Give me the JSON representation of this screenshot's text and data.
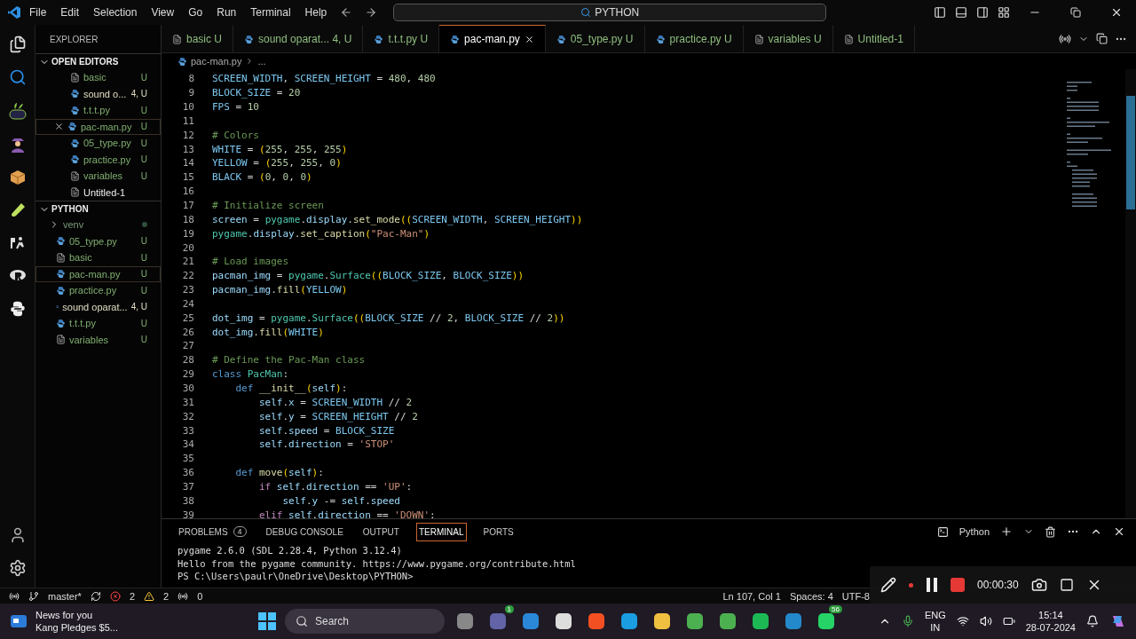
{
  "window": {
    "menu": [
      "File",
      "Edit",
      "Selection",
      "View",
      "Go",
      "Run",
      "Terminal",
      "Help"
    ],
    "command_center": "PYTHON"
  },
  "tabs": [
    {
      "label": "basic",
      "kind": "text",
      "badge": "U",
      "selected": false
    },
    {
      "label": "sound oparat...",
      "kind": "python",
      "badge": "4, U",
      "selected": false
    },
    {
      "label": "t.t.t.py",
      "kind": "python",
      "badge": "U",
      "selected": false
    },
    {
      "label": "pac-man.py",
      "kind": "python",
      "selected": true
    },
    {
      "label": "05_type.py",
      "kind": "python",
      "badge": "U",
      "selected": false
    },
    {
      "label": "practice.py",
      "kind": "python",
      "badge": "U",
      "selected": false
    },
    {
      "label": "variables",
      "kind": "text",
      "badge": "U",
      "selected": false
    },
    {
      "label": "Untitled-1",
      "kind": "text",
      "selected": false
    }
  ],
  "sidebar": {
    "title": "EXPLORER",
    "sections": [
      {
        "title": "OPEN EDITORS",
        "expanded": true,
        "items": [
          {
            "label": "basic",
            "kind": "text",
            "badge": "U",
            "untracked": true,
            "has_errors": false,
            "selected": false
          },
          {
            "label": "sound o...",
            "kind": "python",
            "badge": "4, U",
            "untracked": true,
            "has_errors": true,
            "selected": false
          },
          {
            "label": "t.t.t.py",
            "kind": "python",
            "badge": "U",
            "untracked": true,
            "has_errors": false,
            "selected": false
          },
          {
            "label": "pac-man.py",
            "kind": "python",
            "badge": "U",
            "untracked": true,
            "has_errors": false,
            "selected": true
          },
          {
            "label": "05_type.py",
            "kind": "python",
            "badge": "U",
            "untracked": true,
            "has_errors": false,
            "selected": false
          },
          {
            "label": "practice.py",
            "kind": "python",
            "badge": "U",
            "untracked": true,
            "has_errors": false,
            "selected": false
          },
          {
            "label": "variables",
            "kind": "text",
            "badge": "U",
            "untracked": true,
            "has_errors": false,
            "selected": false
          },
          {
            "label": "Untitled-1",
            "kind": "text",
            "untracked": false,
            "has_errors": false,
            "selected": false
          }
        ]
      },
      {
        "title": "PYTHON",
        "expanded": true,
        "items": [
          {
            "label": "venv",
            "kind": "folder",
            "untracked": true,
            "has_errors": false,
            "selected": false
          },
          {
            "label": "05_type.py",
            "kind": "python",
            "badge": "U",
            "untracked": true,
            "has_errors": false,
            "selected": false
          },
          {
            "label": "basic",
            "kind": "text",
            "badge": "U",
            "untracked": true,
            "has_errors": false,
            "selected": false
          },
          {
            "label": "pac-man.py",
            "kind": "python",
            "badge": "U",
            "untracked": true,
            "has_errors": false,
            "selected": true
          },
          {
            "label": "practice.py",
            "kind": "python",
            "badge": "U",
            "untracked": true,
            "has_errors": false,
            "selected": false
          },
          {
            "label": "sound oparat...",
            "kind": "python",
            "badge": "4, U",
            "untracked": true,
            "has_errors": true,
            "selected": false
          },
          {
            "label": "t.t.t.py",
            "kind": "python",
            "badge": "U",
            "untracked": true,
            "has_errors": false,
            "selected": false
          },
          {
            "label": "variables",
            "kind": "text",
            "badge": "U",
            "untracked": true,
            "has_errors": false,
            "selected": false
          }
        ]
      }
    ]
  },
  "breadcrumb": [
    "pac-man.py",
    "..."
  ],
  "editor": {
    "lines": [
      {
        "n": "8",
        "parts": [
          {
            "kind": "const",
            "text": "SCREEN_WIDTH"
          },
          {
            "kind": "op",
            "text": ", "
          },
          {
            "kind": "const",
            "text": "SCREEN_HEIGHT"
          },
          {
            "kind": "op",
            "text": " = "
          },
          {
            "kind": "num",
            "text": "480"
          },
          {
            "kind": "op",
            "text": ", "
          },
          {
            "kind": "num",
            "text": "480"
          }
        ]
      },
      {
        "n": "9",
        "parts": [
          {
            "kind": "const",
            "text": "BLOCK_SIZE"
          },
          {
            "kind": "op",
            "text": " = "
          },
          {
            "kind": "num",
            "text": "20"
          }
        ]
      },
      {
        "n": "10",
        "parts": [
          {
            "kind": "const",
            "text": "FPS"
          },
          {
            "kind": "op",
            "text": " = "
          },
          {
            "kind": "num",
            "text": "10"
          }
        ]
      },
      {
        "n": "11"
      },
      {
        "n": "12",
        "parts": [
          {
            "kind": "comment",
            "text": "# Colors"
          }
        ]
      },
      {
        "n": "13",
        "parts": [
          {
            "kind": "const",
            "text": "WHITE"
          },
          {
            "kind": "op",
            "text": " = "
          },
          {
            "kind": "paren",
            "text": "("
          },
          {
            "kind": "num",
            "text": "255"
          },
          {
            "kind": "op",
            "text": ", "
          },
          {
            "kind": "num",
            "text": "255"
          },
          {
            "kind": "op",
            "text": ", "
          },
          {
            "kind": "num",
            "text": "255"
          },
          {
            "kind": "paren",
            "text": ")"
          }
        ]
      },
      {
        "n": "14",
        "parts": [
          {
            "kind": "const",
            "text": "YELLOW"
          },
          {
            "kind": "op",
            "text": " = "
          },
          {
            "kind": "paren",
            "text": "("
          },
          {
            "kind": "num",
            "text": "255"
          },
          {
            "kind": "op",
            "text": ", "
          },
          {
            "kind": "num",
            "text": "255"
          },
          {
            "kind": "op",
            "text": ", "
          },
          {
            "kind": "num",
            "text": "0"
          },
          {
            "kind": "paren",
            "text": ")"
          }
        ]
      },
      {
        "n": "15",
        "parts": [
          {
            "kind": "const",
            "text": "BLACK"
          },
          {
            "kind": "op",
            "text": " = "
          },
          {
            "kind": "paren",
            "text": "("
          },
          {
            "kind": "num",
            "text": "0"
          },
          {
            "kind": "op",
            "text": ", "
          },
          {
            "kind": "num",
            "text": "0"
          },
          {
            "kind": "op",
            "text": ", "
          },
          {
            "kind": "num",
            "text": "0"
          },
          {
            "kind": "paren",
            "text": ")"
          }
        ]
      },
      {
        "n": "16"
      },
      {
        "n": "17",
        "parts": [
          {
            "kind": "comment",
            "text": "# Initialize screen"
          }
        ]
      },
      {
        "n": "18",
        "parts": [
          {
            "kind": "var",
            "text": "screen"
          },
          {
            "kind": "op",
            "text": " = "
          },
          {
            "kind": "type",
            "text": "pygame"
          },
          {
            "kind": "op",
            "text": "."
          },
          {
            "kind": "var",
            "text": "display"
          },
          {
            "kind": "op",
            "text": "."
          },
          {
            "kind": "func",
            "text": "set_mode"
          },
          {
            "kind": "paren",
            "text": "(("
          },
          {
            "kind": "const",
            "text": "SCREEN_WIDTH"
          },
          {
            "kind": "op",
            "text": ", "
          },
          {
            "kind": "const",
            "text": "SCREEN_HEIGHT"
          },
          {
            "kind": "paren",
            "text": "))"
          }
        ]
      },
      {
        "n": "19",
        "parts": [
          {
            "kind": "type",
            "text": "pygame"
          },
          {
            "kind": "op",
            "text": "."
          },
          {
            "kind": "var",
            "text": "display"
          },
          {
            "kind": "op",
            "text": "."
          },
          {
            "kind": "func",
            "text": "set_caption"
          },
          {
            "kind": "paren",
            "text": "("
          },
          {
            "kind": "str",
            "text": "\"Pac-Man\""
          },
          {
            "kind": "paren",
            "text": ")"
          }
        ]
      },
      {
        "n": "20"
      },
      {
        "n": "21",
        "parts": [
          {
            "kind": "comment",
            "text": "# Load images"
          }
        ]
      },
      {
        "n": "22",
        "parts": [
          {
            "kind": "var",
            "text": "pacman_img"
          },
          {
            "kind": "op",
            "text": " = "
          },
          {
            "kind": "type",
            "text": "pygame"
          },
          {
            "kind": "op",
            "text": "."
          },
          {
            "kind": "type",
            "text": "Surface"
          },
          {
            "kind": "paren",
            "text": "(("
          },
          {
            "kind": "const",
            "text": "BLOCK_SIZE"
          },
          {
            "kind": "op",
            "text": ", "
          },
          {
            "kind": "const",
            "text": "BLOCK_SIZE"
          },
          {
            "kind": "paren",
            "text": "))"
          }
        ]
      },
      {
        "n": "23",
        "parts": [
          {
            "kind": "var",
            "text": "pacman_img"
          },
          {
            "kind": "op",
            "text": "."
          },
          {
            "kind": "func",
            "text": "fill"
          },
          {
            "kind": "paren",
            "text": "("
          },
          {
            "kind": "const",
            "text": "YELLOW"
          },
          {
            "kind": "paren",
            "text": ")"
          }
        ]
      },
      {
        "n": "24"
      },
      {
        "n": "25",
        "parts": [
          {
            "kind": "var",
            "text": "dot_img"
          },
          {
            "kind": "op",
            "text": " = "
          },
          {
            "kind": "type",
            "text": "pygame"
          },
          {
            "kind": "op",
            "text": "."
          },
          {
            "kind": "type",
            "text": "Surface"
          },
          {
            "kind": "paren",
            "text": "(("
          },
          {
            "kind": "const",
            "text": "BLOCK_SIZE"
          },
          {
            "kind": "op",
            "text": " // "
          },
          {
            "kind": "num",
            "text": "2"
          },
          {
            "kind": "op",
            "text": ", "
          },
          {
            "kind": "const",
            "text": "BLOCK_SIZE"
          },
          {
            "kind": "op",
            "text": " // "
          },
          {
            "kind": "num",
            "text": "2"
          },
          {
            "kind": "paren",
            "text": "))"
          }
        ]
      },
      {
        "n": "26",
        "parts": [
          {
            "kind": "var",
            "text": "dot_img"
          },
          {
            "kind": "op",
            "text": "."
          },
          {
            "kind": "func",
            "text": "fill"
          },
          {
            "kind": "paren",
            "text": "("
          },
          {
            "kind": "const",
            "text": "WHITE"
          },
          {
            "kind": "paren",
            "text": ")"
          }
        ]
      },
      {
        "n": "27"
      },
      {
        "n": "28",
        "parts": [
          {
            "kind": "comment",
            "text": "# Define the Pac-Man class"
          }
        ]
      },
      {
        "n": "29",
        "parts": [
          {
            "kind": "keyword",
            "text": "class "
          },
          {
            "kind": "type",
            "text": "PacMan"
          },
          {
            "kind": "op",
            "text": ":"
          }
        ]
      },
      {
        "n": "30",
        "parts": [
          {
            "kind": "keyword",
            "text": "    def "
          },
          {
            "kind": "func",
            "text": "__init__"
          },
          {
            "kind": "paren",
            "text": "("
          },
          {
            "kind": "var",
            "text": "self"
          },
          {
            "kind": "paren",
            "text": ")"
          },
          {
            "kind": "op",
            "text": ":"
          }
        ]
      },
      {
        "n": "31",
        "parts": [
          {
            "kind": "var",
            "text": "        self"
          },
          {
            "kind": "op",
            "text": "."
          },
          {
            "kind": "var",
            "text": "x"
          },
          {
            "kind": "op",
            "text": " = "
          },
          {
            "kind": "const",
            "text": "SCREEN_WIDTH"
          },
          {
            "kind": "op",
            "text": " // "
          },
          {
            "kind": "num",
            "text": "2"
          }
        ]
      },
      {
        "n": "32",
        "parts": [
          {
            "kind": "var",
            "text": "        self"
          },
          {
            "kind": "op",
            "text": "."
          },
          {
            "kind": "var",
            "text": "y"
          },
          {
            "kind": "op",
            "text": " = "
          },
          {
            "kind": "const",
            "text": "SCREEN_HEIGHT"
          },
          {
            "kind": "op",
            "text": " // "
          },
          {
            "kind": "num",
            "text": "2"
          }
        ]
      },
      {
        "n": "33",
        "parts": [
          {
            "kind": "var",
            "text": "        self"
          },
          {
            "kind": "op",
            "text": "."
          },
          {
            "kind": "var",
            "text": "speed"
          },
          {
            "kind": "op",
            "text": " = "
          },
          {
            "kind": "const",
            "text": "BLOCK_SIZE"
          }
        ]
      },
      {
        "n": "34",
        "parts": [
          {
            "kind": "var",
            "text": "        self"
          },
          {
            "kind": "op",
            "text": "."
          },
          {
            "kind": "var",
            "text": "direction"
          },
          {
            "kind": "op",
            "text": " = "
          },
          {
            "kind": "str",
            "text": "'STOP'"
          }
        ]
      },
      {
        "n": "35"
      },
      {
        "n": "36",
        "parts": [
          {
            "kind": "keyword",
            "text": "    def "
          },
          {
            "kind": "func",
            "text": "move"
          },
          {
            "kind": "paren",
            "text": "("
          },
          {
            "kind": "var",
            "text": "self"
          },
          {
            "kind": "paren",
            "text": ")"
          },
          {
            "kind": "op",
            "text": ":"
          }
        ]
      },
      {
        "n": "37",
        "parts": [
          {
            "kind": "control",
            "text": "        if "
          },
          {
            "kind": "var",
            "text": "self"
          },
          {
            "kind": "op",
            "text": "."
          },
          {
            "kind": "var",
            "text": "direction"
          },
          {
            "kind": "op",
            "text": " == "
          },
          {
            "kind": "str",
            "text": "'UP'"
          },
          {
            "kind": "op",
            "text": ":"
          }
        ]
      },
      {
        "n": "38",
        "parts": [
          {
            "kind": "var",
            "text": "            self"
          },
          {
            "kind": "op",
            "text": "."
          },
          {
            "kind": "var",
            "text": "y"
          },
          {
            "kind": "op",
            "text": " -= "
          },
          {
            "kind": "var",
            "text": "self"
          },
          {
            "kind": "op",
            "text": "."
          },
          {
            "kind": "var",
            "text": "speed"
          }
        ]
      },
      {
        "n": "39",
        "parts": [
          {
            "kind": "control",
            "text": "        elif "
          },
          {
            "kind": "var",
            "text": "self"
          },
          {
            "kind": "op",
            "text": "."
          },
          {
            "kind": "var",
            "text": "direction"
          },
          {
            "kind": "op",
            "text": " == "
          },
          {
            "kind": "str",
            "text": "'DOWN'"
          },
          {
            "kind": "op",
            "text": ":"
          }
        ]
      }
    ]
  },
  "panel": {
    "tabs": [
      {
        "label": "PROBLEMS",
        "count": "4",
        "selected": false
      },
      {
        "label": "DEBUG CONSOLE",
        "selected": false
      },
      {
        "label": "OUTPUT",
        "selected": false
      },
      {
        "label": "TERMINAL",
        "selected": true
      },
      {
        "label": "PORTS",
        "selected": false
      }
    ],
    "shell": "Python",
    "terminal_lines": [
      "pygame 2.6.0 (SDL 2.28.4, Python 3.12.4)",
      "Hello from the pygame community. https://www.pygame.org/contribute.html",
      "PS C:\\Users\\paulr\\OneDrive\\Desktop\\PYTHON>"
    ]
  },
  "status_bar": {
    "branch": "master*",
    "errors": "2",
    "warnings": "2",
    "ports": "0",
    "position": "Ln 107, Col 1",
    "spaces": "Spaces: 4",
    "encoding": "UTF-8"
  },
  "recorder": {
    "timer": "00:00:30"
  },
  "taskbar": {
    "news_title": "News for you",
    "news_text": "Kang Pledges $5...",
    "search_placeholder": "Search",
    "apps": [
      {
        "kind": "files"
      },
      {
        "kind": "teams",
        "badge": "1"
      },
      {
        "kind": "help"
      },
      {
        "kind": "store"
      },
      {
        "kind": "diamond"
      },
      {
        "kind": "edge"
      },
      {
        "kind": "folder"
      },
      {
        "kind": "chrome"
      },
      {
        "kind": "chrome"
      },
      {
        "kind": "spotify"
      },
      {
        "kind": "vscode"
      },
      {
        "kind": "whatsapp",
        "badge": "56"
      }
    ],
    "language": [
      "ENG",
      "IN"
    ],
    "time": "15:14",
    "date": "28-07-2024"
  }
}
